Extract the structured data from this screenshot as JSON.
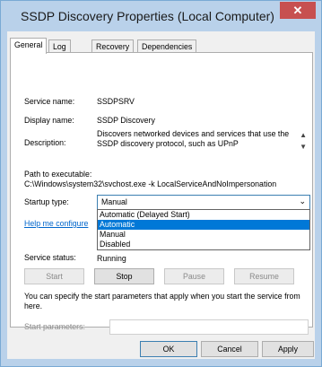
{
  "window": {
    "title": "SSDP Discovery Properties (Local Computer)",
    "close_glyph": "✕"
  },
  "tabs": [
    {
      "label": "General"
    },
    {
      "label": "Log On"
    },
    {
      "label": "Recovery"
    },
    {
      "label": "Dependencies"
    }
  ],
  "general": {
    "service_name_label": "Service name:",
    "service_name_value": "SSDPSRV",
    "display_name_label": "Display name:",
    "display_name_value": "SSDP Discovery",
    "description_label": "Description:",
    "description_value": "Discovers networked devices and services that use the SSDP discovery protocol, such as UPnP",
    "path_label": "Path to executable:",
    "path_value": "C:\\Windows\\system32\\svchost.exe -k LocalServiceAndNoImpersonation",
    "startup_type_label": "Startup type:",
    "startup_type_value": "Manual",
    "startup_options": [
      "Automatic (Delayed Start)",
      "Automatic",
      "Manual",
      "Disabled"
    ],
    "help_link": "Help me configure",
    "status_label": "Service status:",
    "status_value": "Running",
    "buttons": {
      "start": "Start",
      "stop": "Stop",
      "pause": "Pause",
      "resume": "Resume"
    },
    "params_note": "You can specify the start parameters that apply when you start the service from here.",
    "params_label": "Start parameters:",
    "params_value": ""
  },
  "footer": {
    "ok": "OK",
    "cancel": "Cancel",
    "apply": "Apply"
  }
}
